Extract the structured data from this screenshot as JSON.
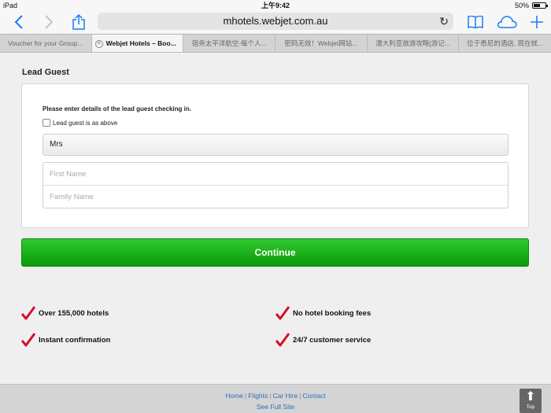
{
  "status_bar": {
    "device": "iPad",
    "time": "上午9:42",
    "battery": "50%"
  },
  "browser": {
    "url": "mhotels.webjet.com.au",
    "tabs": [
      {
        "label": "Voucher for your Group..."
      },
      {
        "label": "Webjet Hotels – Boo...",
        "active": true
      },
      {
        "label": "宿务太平洋航空-每个人..."
      },
      {
        "label": "密码无效！Webjet网站..."
      },
      {
        "label": "澳大利亚旅游攻略[游记..."
      },
      {
        "label": "位于悉尼的酒店, 现在就..."
      }
    ]
  },
  "form": {
    "section_title": "Lead Guest",
    "instruction": "Please enter details of the lead guest checking in.",
    "checkbox_label": "Lead guest is as above",
    "title_value": "Mrs",
    "first_name_placeholder": "First Name",
    "family_name_placeholder": "Family Name",
    "continue_label": "Continue"
  },
  "features": [
    "Over 155,000 hotels",
    "No hotel booking fees",
    "Instant confirmation",
    "24/7 customer service"
  ],
  "footer": {
    "links": [
      "Home",
      "Flights",
      "Car Hire",
      "Contact"
    ],
    "full_site": "See Full Site",
    "top_label": "Top"
  },
  "colors": {
    "accent": "#1a7cf5",
    "continue_green": "#19b019",
    "check_red": "#d0102a",
    "link": "#2a6fb8"
  }
}
